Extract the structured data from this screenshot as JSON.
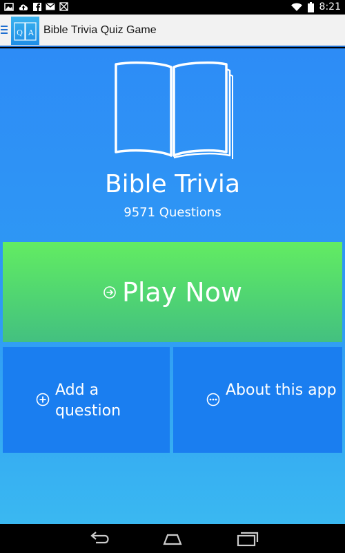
{
  "status_bar": {
    "time": "8:21",
    "left_icons": [
      "image-icon",
      "cloud-upload-icon",
      "facebook-icon",
      "mail-icon",
      "no-signal-icon"
    ],
    "right_icons": [
      "wifi-icon",
      "battery-icon"
    ]
  },
  "action_bar": {
    "title": "Bible Trivia Quiz Game",
    "logo_text": "Q A"
  },
  "hero": {
    "title": "Bible Trivia",
    "subtitle": "9571 Questions"
  },
  "play_button": {
    "label": "Play Now"
  },
  "tiles": {
    "add": {
      "label": "Add a question"
    },
    "about": {
      "label": "About this app"
    }
  },
  "colors": {
    "content_top": "#2d8cf6",
    "content_bottom": "#3ab8f1",
    "play_top": "#63ec62",
    "play_bottom": "#43c080",
    "tile": "#1a7ef0"
  }
}
